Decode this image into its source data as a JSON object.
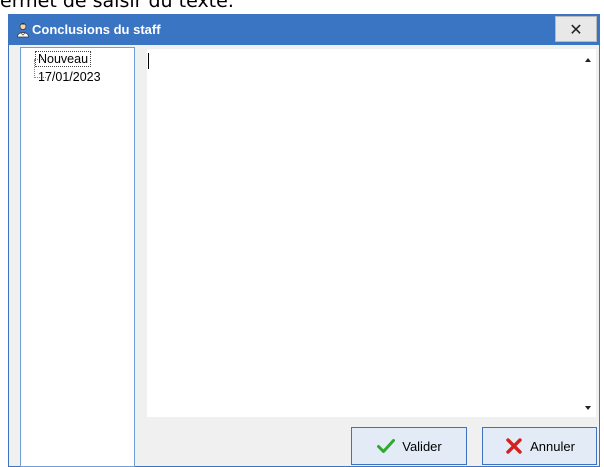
{
  "background_text": "ermet de saisir du texte.",
  "window": {
    "title": "Conclusions du staff",
    "close_label": "✕"
  },
  "tree": {
    "items": [
      {
        "label": "Nouveau",
        "selected": true
      },
      {
        "label": "17/01/2023",
        "selected": false
      }
    ]
  },
  "editor": {
    "value": ""
  },
  "buttons": {
    "validate_label": "Valider",
    "cancel_label": "Annuler"
  },
  "colors": {
    "titlebar": "#3a75c4",
    "accent_border": "#3d73c0",
    "check_green": "#2eaa2e",
    "cross_red": "#d42020"
  },
  "icons": {
    "app": "staff-person-icon",
    "validate": "checkmark-icon",
    "cancel": "cross-icon"
  }
}
